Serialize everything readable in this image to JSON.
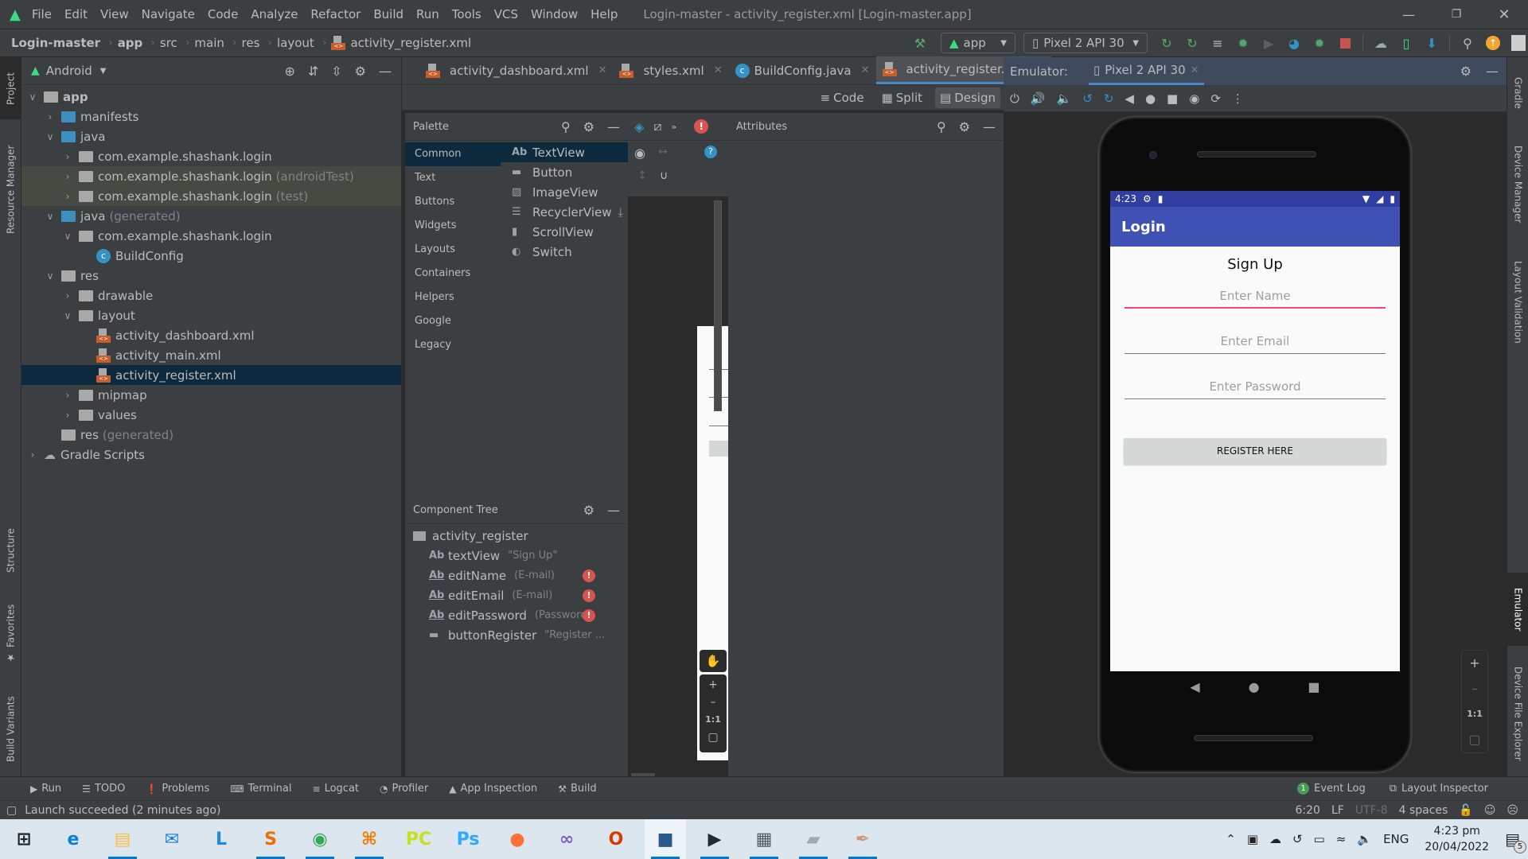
{
  "window": {
    "title": "Login-master - activity_register.xml [Login-master.app]",
    "menu": [
      "File",
      "Edit",
      "View",
      "Navigate",
      "Code",
      "Analyze",
      "Refactor",
      "Build",
      "Run",
      "Tools",
      "VCS",
      "Window",
      "Help"
    ]
  },
  "breadcrumb": [
    "Login-master",
    "app",
    "src",
    "main",
    "res",
    "layout",
    "activity_register.xml"
  ],
  "toolbar": {
    "run_config": "app",
    "device": "Pixel 2 API 30",
    "icons": [
      "hammer-icon",
      "apply-changes-restart-icon",
      "apply-code-changes-icon",
      "sync-icon",
      "debug-icon",
      "attach-profiler-icon",
      "profile-icon",
      "attach-debugger-icon",
      "stop-icon",
      "gradle-sync-icon",
      "device-manager-icon",
      "sdk-manager-icon",
      "search-icon",
      "update-icon",
      "account-icon"
    ],
    "accent_stop": "#c75450",
    "accent_update": "#f0a732"
  },
  "left_strip": {
    "tabs": [
      "Project",
      "Resource Manager",
      "Structure",
      "Favorites",
      "Build Variants"
    ]
  },
  "right_strip": {
    "tabs": [
      "Gradle",
      "Device Manager",
      "Layout Validation",
      "Emulator",
      "Device File Explorer"
    ]
  },
  "project": {
    "view": "Android",
    "tree": [
      {
        "label": "app",
        "level": 0,
        "expanded": true,
        "icon": "module-folder-icon",
        "bold": true
      },
      {
        "label": "manifests",
        "level": 1,
        "expanded": false,
        "icon": "folder-icon"
      },
      {
        "label": "java",
        "level": 1,
        "expanded": true,
        "icon": "folder-icon"
      },
      {
        "label": "com.example.shashank.login",
        "level": 2,
        "expanded": false,
        "icon": "package-icon"
      },
      {
        "label": "com.example.shashank.login",
        "suffix": "(androidTest)",
        "level": 2,
        "expanded": false,
        "icon": "package-icon",
        "highlight": "green"
      },
      {
        "label": "com.example.shashank.login",
        "suffix": "(test)",
        "level": 2,
        "expanded": false,
        "icon": "package-icon",
        "highlight": "green"
      },
      {
        "label": "java",
        "suffix": "(generated)",
        "level": 1,
        "expanded": true,
        "icon": "generated-folder-icon"
      },
      {
        "label": "com.example.shashank.login",
        "level": 2,
        "expanded": true,
        "icon": "package-icon"
      },
      {
        "label": "BuildConfig",
        "level": 3,
        "icon": "class-icon"
      },
      {
        "label": "res",
        "level": 1,
        "expanded": true,
        "icon": "res-folder-icon"
      },
      {
        "label": "drawable",
        "level": 2,
        "expanded": false,
        "icon": "package-icon"
      },
      {
        "label": "layout",
        "level": 2,
        "expanded": true,
        "icon": "package-icon"
      },
      {
        "label": "activity_dashboard.xml",
        "level": 3,
        "icon": "xml-file-icon"
      },
      {
        "label": "activity_main.xml",
        "level": 3,
        "icon": "xml-file-icon"
      },
      {
        "label": "activity_register.xml",
        "level": 3,
        "icon": "xml-file-icon",
        "selected": true
      },
      {
        "label": "mipmap",
        "level": 2,
        "expanded": false,
        "icon": "package-icon"
      },
      {
        "label": "values",
        "level": 2,
        "expanded": false,
        "icon": "package-icon"
      },
      {
        "label": "res",
        "suffix": "(generated)",
        "level": 1,
        "icon": "res-folder-icon"
      },
      {
        "label": "Gradle Scripts",
        "level": 0,
        "expanded": false,
        "icon": "gradle-icon"
      }
    ]
  },
  "editor": {
    "tabs": [
      {
        "label": "activity_dashboard.xml",
        "icon": "xml-file-icon"
      },
      {
        "label": "styles.xml",
        "icon": "xml-file-icon"
      },
      {
        "label": "BuildConfig.java",
        "icon": "class-icon"
      },
      {
        "label": "activity_register.xml",
        "icon": "xml-file-icon",
        "active": true
      }
    ],
    "modes": [
      "Code",
      "Split",
      "Design"
    ],
    "active_mode": "Design"
  },
  "palette": {
    "title": "Palette",
    "categories": [
      "Common",
      "Text",
      "Buttons",
      "Widgets",
      "Layouts",
      "Containers",
      "Helpers",
      "Google",
      "Legacy"
    ],
    "selected_category": "Common",
    "items": [
      {
        "label": "TextView",
        "icon": "Ab"
      },
      {
        "label": "Button",
        "icon": "button-icon"
      },
      {
        "label": "ImageView",
        "icon": "image-icon"
      },
      {
        "label": "RecyclerView",
        "icon": "list-icon",
        "download": true
      },
      {
        "label": "ScrollView",
        "icon": "scrollview-icon"
      },
      {
        "label": "Switch",
        "icon": "switch-icon"
      }
    ]
  },
  "component_tree": {
    "title": "Component Tree",
    "root": "activity_register",
    "items": [
      {
        "name": "textView",
        "hint": "\"Sign Up\"",
        "error": false
      },
      {
        "name": "editName",
        "hint": "(E-mail)",
        "error": true
      },
      {
        "name": "editEmail",
        "hint": "(E-mail)",
        "error": true
      },
      {
        "name": "editPassword",
        "hint": "(Password)",
        "error": true
      },
      {
        "name": "buttonRegister",
        "hint": "\"Register ...",
        "error": false
      }
    ]
  },
  "design_zoom": {
    "fit": "1:1"
  },
  "attributes": {
    "title": "Attributes"
  },
  "emulator": {
    "label": "Emulator:",
    "device_tab": "Pixel 2 API 30",
    "zoom_reset": "1:1"
  },
  "phone": {
    "time": "4:23",
    "app_title": "Login",
    "heading": "Sign Up",
    "fields": [
      {
        "placeholder": "Enter Name",
        "focused": true
      },
      {
        "placeholder": "Enter Email",
        "focused": false
      },
      {
        "placeholder": "Enter Password",
        "focused": false
      }
    ],
    "button": "REGISTER HERE",
    "colors": {
      "status": "#303f9f",
      "appbar": "#3f51b5",
      "accent": "#ff4081"
    }
  },
  "bottom_tools": {
    "left": [
      "Run",
      "TODO",
      "Problems",
      "Terminal",
      "Logcat",
      "Profiler",
      "App Inspection",
      "Build"
    ],
    "event_log": "Event Log",
    "event_count": "1",
    "layout_inspector": "Layout Inspector"
  },
  "status": {
    "message": "Launch succeeded (2 minutes ago)",
    "position": "6:20",
    "line_sep": "LF",
    "encoding": "UTF-8",
    "indent": "4 spaces"
  },
  "taskbar": {
    "apps": [
      "Start",
      "Edge",
      "File Explorer",
      "Mail",
      "L",
      "Sublime Text",
      "Chrome",
      "XAMPP",
      "PyCharm",
      "Photoshop",
      "Firefox",
      "Visual Studio",
      "Office",
      "Android Studio",
      "Android Emulator",
      "Calculator",
      "Notepad",
      "Paint"
    ],
    "lang": "ENG",
    "time": "4:23 pm",
    "date": "20/04/2022",
    "notifications": "5"
  }
}
